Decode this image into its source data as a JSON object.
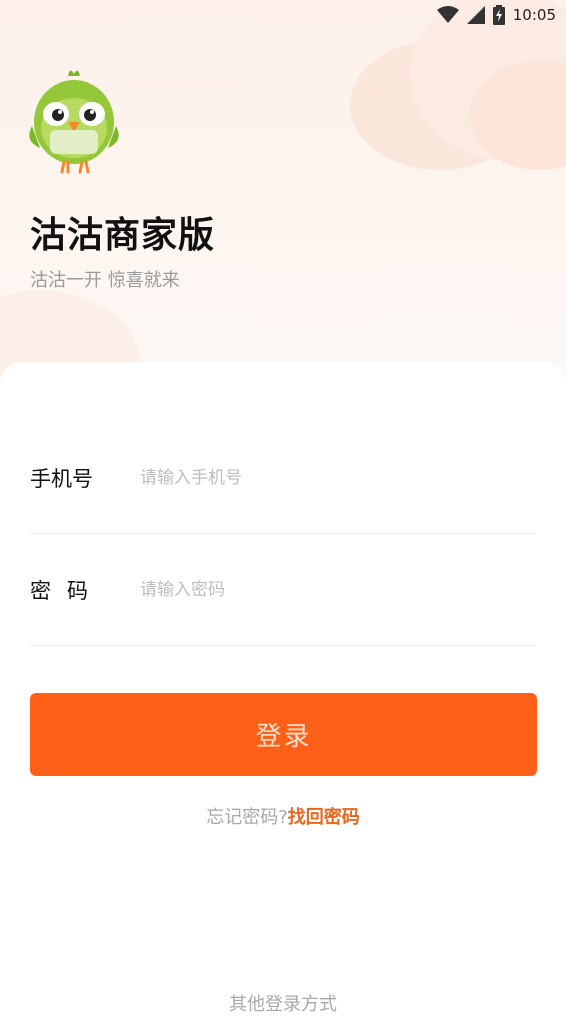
{
  "status_bar": {
    "time": "10:05",
    "icons": [
      "wifi-icon",
      "signal-icon",
      "battery-charging-icon"
    ]
  },
  "app": {
    "logo": "bird-mascot-logo",
    "title": "沽沽商家版",
    "slogan": "沽沽一开 惊喜就来"
  },
  "form": {
    "phone_label": "手机号",
    "phone_placeholder": "请输入手机号",
    "phone_value": "",
    "password_label": "密码",
    "password_placeholder": "请输入密码",
    "password_value": ""
  },
  "actions": {
    "login_label": "登录",
    "forgot_prefix": "忘记密码?",
    "forgot_link": "找回密码",
    "other_methods": "其他登录方式"
  },
  "colors": {
    "accent": "#fe6018",
    "link": "#e8661d",
    "muted_text": "#a8a8a8",
    "hero_bg": "#fdf1ea"
  }
}
